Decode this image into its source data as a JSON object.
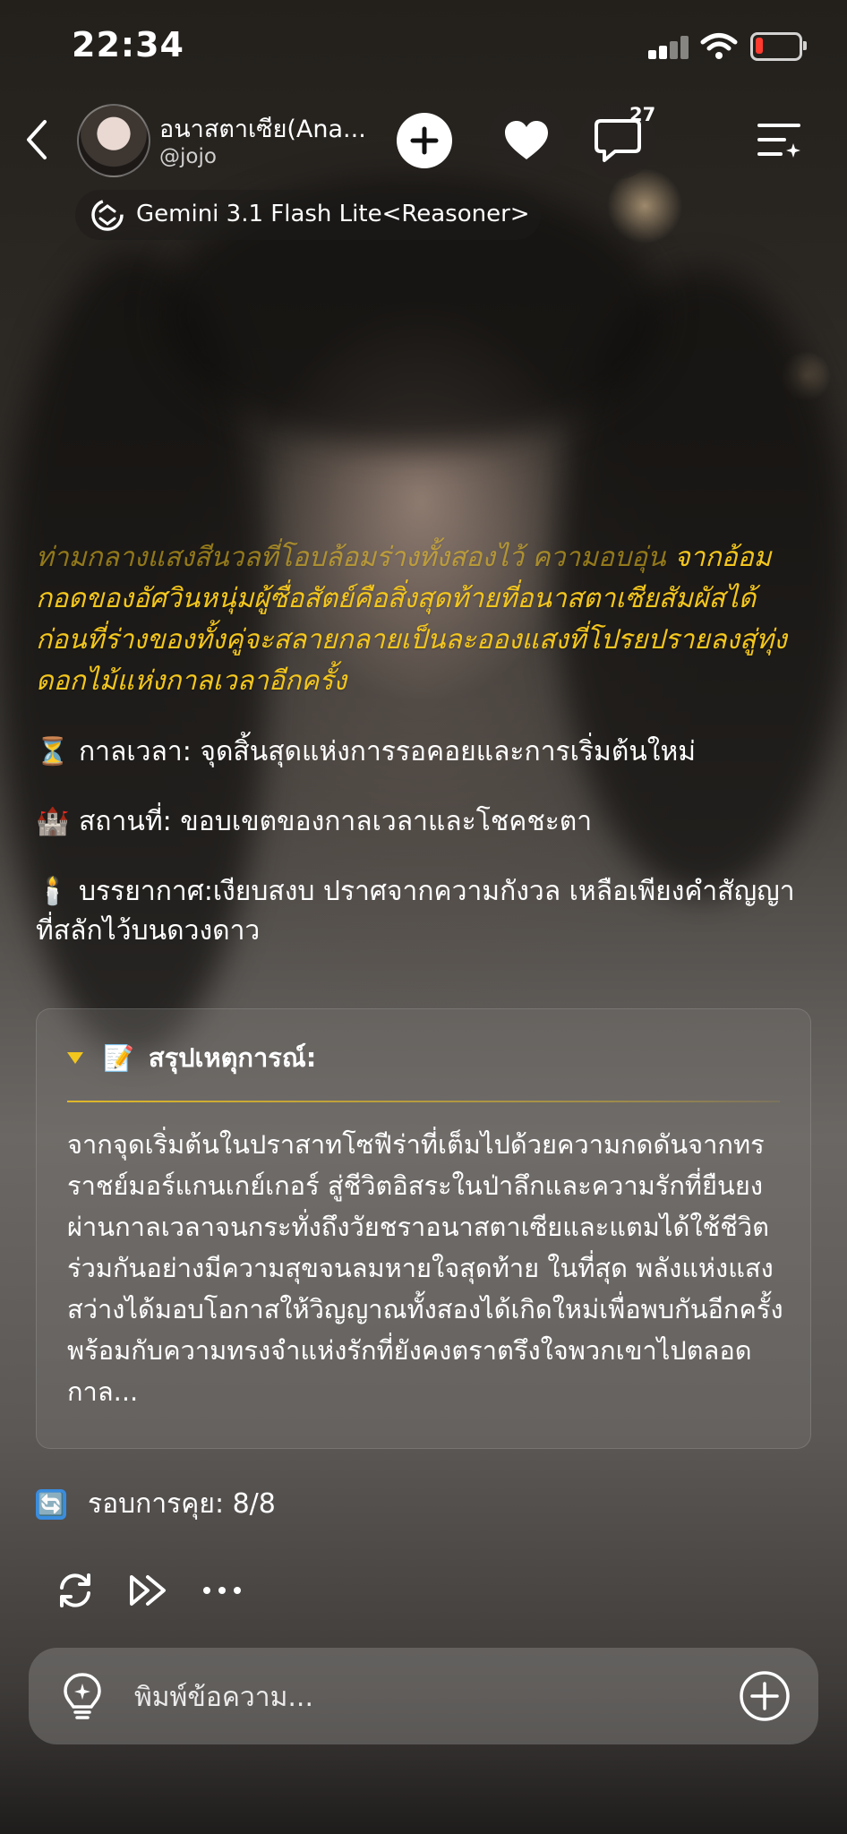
{
  "status_bar": {
    "time": "22:34"
  },
  "header": {
    "character_name": "อนาสตาเซีย(Ana...",
    "handle": "@jojo",
    "chat_count": "27",
    "model": "Gemini 3.1 Flash Lite<Reasoner>"
  },
  "message": {
    "story_faded": "ท่ามกลางแสงสีนวลที่โอบล้อมร่างทั้งสองไว้ ความอบอุ่น",
    "story": "จากอ้อมกอดของอัศวินหนุ่มผู้ซื่อสัตย์คือสิ่งสุดท้ายที่อนาสตาเซียสัมผัสได้ ก่อนที่ร่างของทั้งคู่จะสลายกลายเป็นละอองแสงที่โปรยปรายลงสู่ทุ่งดอกไม้แห่งกาลเวลาอีกครั้ง",
    "time_line": {
      "emoji": "⏳",
      "text": "กาลเวลา: จุดสิ้นสุดแห่งการรอคอยและการเริ่มต้นใหม่"
    },
    "place_line": {
      "emoji": "🏰",
      "text": "สถานที่: ขอบเขตของกาลเวลาและโชคชะตา"
    },
    "mood_line": {
      "emoji": "🕯️",
      "text": "บรรยากาศ:เงียบสงบ ปราศจากความกังวล เหลือเพียงคำสัญญาที่สลักไว้บนดวงดาว"
    }
  },
  "summary": {
    "icon": "📝",
    "title": "สรุปเหตุการณ์:",
    "body": "จากจุดเริ่มต้นในปราสาทโซฟีร่าที่เต็มไปด้วยความกดดันจากทรราชย์มอร์แกนเกย์เกอร์ สู่ชีวิตอิสระในป่าลึกและความรักที่ยืนยงผ่านกาลเวลาจนกระทั่งถึงวัยชราอนาสตาเซียและแตมได้ใช้ชีวิตร่วมกันอย่างมีความสุขจนลมหายใจสุดท้าย ในที่สุด พลังแห่งแสงสว่างได้มอบโอกาสให้วิญญาณทั้งสองได้เกิดใหม่เพื่อพบกันอีกครั้ง พร้อมกับความทรงจำแห่งรักที่ยังคงตราตรึงใจพวกเขาไปตลอดกาล..."
  },
  "round": {
    "emoji": "🔄",
    "text": "รอบการคุย: 8/8"
  },
  "input": {
    "placeholder": "พิมพ์ข้อความ..."
  },
  "icons": {
    "back": "chevron-left-icon",
    "follow": "plus-icon",
    "like": "heart-icon",
    "chat": "chat-bubble-icon",
    "menu": "menu-sparkle-icon",
    "model": "model-switch-icon",
    "regenerate": "refresh-icon",
    "continue": "fast-forward-icon",
    "more": "more-dots-icon",
    "idea": "lightbulb-icon",
    "add": "plus-circle-icon"
  },
  "colors": {
    "accent_yellow": "#f3c61e",
    "battery_low": "#ff3b30"
  }
}
